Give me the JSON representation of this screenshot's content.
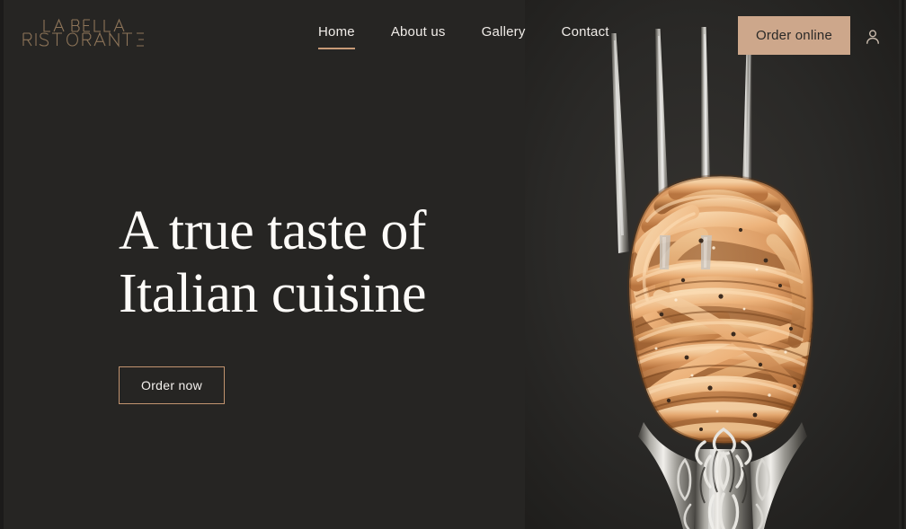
{
  "brand": {
    "line1": "LA BELLA",
    "line2": "RISTORANTE",
    "color": "#8e7559"
  },
  "nav": {
    "items": [
      {
        "label": "Home",
        "active": true
      },
      {
        "label": "About us",
        "active": false
      },
      {
        "label": "Gallery",
        "active": false
      },
      {
        "label": "Contact",
        "active": false
      }
    ],
    "active_underline_color": "#c89a77"
  },
  "header": {
    "order_online_label": "Order online",
    "order_online_bg": "#cda78b",
    "account_icon": "user-account-icon"
  },
  "hero": {
    "title_line_1": "A true taste of",
    "title_line_2": "Italian cuisine",
    "cta_label": "Order now",
    "cta_border_color": "#c2946f",
    "image_alt": "spaghetti twirled on an ornate silver fork",
    "background_color": "#262523"
  },
  "colors": {
    "page_background": "#262523",
    "text_primary": "#fdfbf8",
    "accent_tan": "#cda78b",
    "accent_copper": "#c89a77"
  }
}
